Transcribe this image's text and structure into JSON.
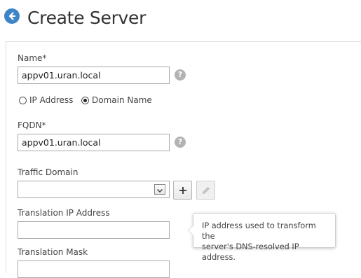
{
  "header": {
    "title": "Create Server",
    "back_icon": "arrow-left-circle-icon",
    "accent_color": "#3d85c6"
  },
  "form": {
    "name": {
      "label": "Name*",
      "value": "appv01.uran.local",
      "help": "?"
    },
    "address_type": {
      "options": [
        {
          "label": "IP Address",
          "checked": false
        },
        {
          "label": "Domain Name",
          "checked": true
        }
      ]
    },
    "fqdn": {
      "label": "FQDN*",
      "value": "appv01.uran.local",
      "help": "?"
    },
    "traffic_domain": {
      "label": "Traffic Domain",
      "value": "",
      "add_icon": "plus-icon",
      "edit_icon": "pencil-icon"
    },
    "translation_ip": {
      "label": "Translation IP Address",
      "value": ""
    },
    "translation_mask": {
      "label": "Translation Mask"
    }
  },
  "tooltip": {
    "text_line1": "IP address used to transform the",
    "text_line2": "server's DNS-resolved IP address."
  }
}
